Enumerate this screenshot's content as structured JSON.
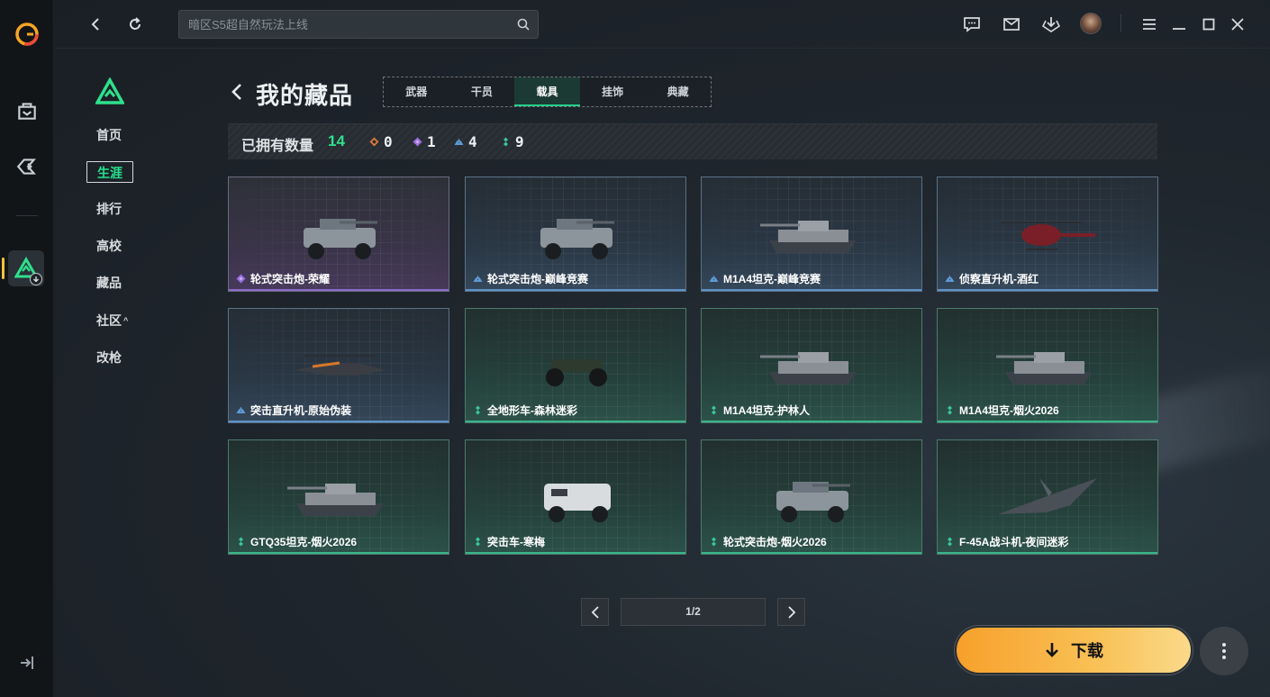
{
  "colors": {
    "accent_green": "#2fe08b",
    "rarity_orange": "#e07a3a",
    "rarity_purple": "#9b6fe0",
    "rarity_blue": "#5e9bd6",
    "rarity_green": "#3ac79a",
    "download_orange": "#f7a02b"
  },
  "topbar": {
    "search_placeholder": "暗区S5超自然玩法上线"
  },
  "nav": {
    "items": [
      {
        "label": "首页",
        "active": false
      },
      {
        "label": "生涯",
        "active": true
      },
      {
        "label": "排行",
        "active": false
      },
      {
        "label": "高校",
        "active": false
      },
      {
        "label": "藏品",
        "active": false
      },
      {
        "label": "社区",
        "active": false,
        "caret": "^"
      },
      {
        "label": "改枪",
        "active": false
      }
    ]
  },
  "header": {
    "title": "我的藏品",
    "tabs": [
      {
        "label": "武器",
        "active": false
      },
      {
        "label": "干员",
        "active": false
      },
      {
        "label": "载具",
        "active": true
      },
      {
        "label": "挂饰",
        "active": false
      },
      {
        "label": "典藏",
        "active": false
      }
    ]
  },
  "stats": {
    "label": "已拥有数量",
    "total": "14",
    "counts": [
      {
        "rarity": "orange",
        "icon": "orange-rarity-icon",
        "value": "0"
      },
      {
        "rarity": "purple",
        "icon": "purple-rarity-icon",
        "value": "1"
      },
      {
        "rarity": "blue",
        "icon": "blue-rarity-icon",
        "value": "4"
      },
      {
        "rarity": "green",
        "icon": "green-rarity-icon",
        "value": "9"
      }
    ]
  },
  "items": [
    {
      "name": "轮式突击炮-荣耀",
      "rarity": "purple",
      "vehicle": "armored-car-icon"
    },
    {
      "name": "轮式突击炮-巅峰竞赛",
      "rarity": "blue",
      "vehicle": "armored-car-icon"
    },
    {
      "name": "M1A4坦克-巅峰竞赛",
      "rarity": "blue",
      "vehicle": "tank-icon"
    },
    {
      "name": "侦察直升机-酒红",
      "rarity": "blue",
      "vehicle": "helicopter-icon"
    },
    {
      "name": "突击直升机-原始伪装",
      "rarity": "blue",
      "vehicle": "attack-helicopter-icon"
    },
    {
      "name": "全地形车-森林迷彩",
      "rarity": "green",
      "vehicle": "atv-icon"
    },
    {
      "name": "M1A4坦克-护林人",
      "rarity": "green",
      "vehicle": "tank-icon"
    },
    {
      "name": "M1A4坦克-烟火2026",
      "rarity": "green",
      "vehicle": "tank-icon"
    },
    {
      "name": "GTQ35坦克-烟火2026",
      "rarity": "green",
      "vehicle": "tank-icon"
    },
    {
      "name": "突击车-寒梅",
      "rarity": "green",
      "vehicle": "assault-vehicle-icon"
    },
    {
      "name": "轮式突击炮-烟火2026",
      "rarity": "green",
      "vehicle": "armored-car-icon"
    },
    {
      "name": "F-45A战斗机-夜间迷彩",
      "rarity": "green",
      "vehicle": "fighter-jet-icon"
    }
  ],
  "pagination": {
    "page_text": "1/2"
  },
  "download": {
    "label": "下载"
  }
}
